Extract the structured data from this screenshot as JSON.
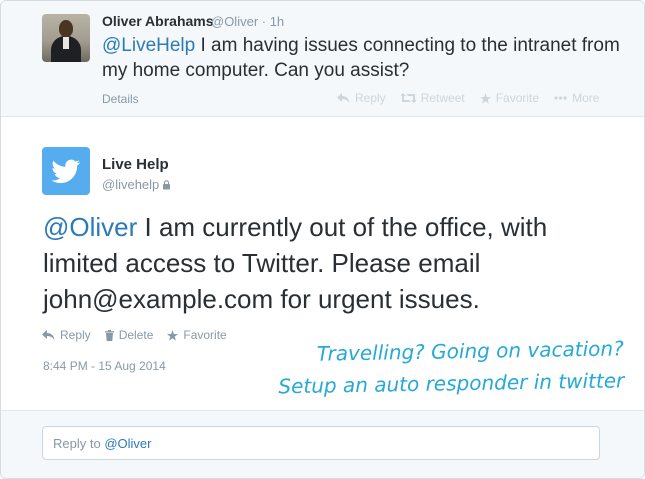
{
  "parent_tweet": {
    "author_name": "Oliver Abrahams",
    "handle_time": "@Oliver · 1h",
    "mention": "@LiveHelp",
    "text": " I am having issues connecting to the intranet from my home computer. Can you assist?",
    "details_label": "Details",
    "actions": {
      "reply": "Reply",
      "retweet": "Retweet",
      "favorite": "Favorite",
      "more": "More"
    }
  },
  "main_tweet": {
    "author_name": "Live Help",
    "handle": "@livehelp",
    "mention": "@Oliver",
    "text": " I am currently out of the office, with limited access to Twitter. Please email john@example.com for urgent issues.",
    "actions": {
      "reply": "Reply",
      "delete": "Delete",
      "favorite": "Favorite"
    },
    "timestamp": "8:44 PM - 15 Aug 2014"
  },
  "callout": {
    "line1": "Travelling? Going on vacation?",
    "line2": "Setup an auto responder in twitter"
  },
  "reply_box": {
    "prefix": "Reply to ",
    "mention": "@Oliver"
  },
  "colors": {
    "accent": "#2b7bb9",
    "twitter_blue": "#55acee",
    "callout": "#26a9d6",
    "muted": "#8899a6"
  }
}
